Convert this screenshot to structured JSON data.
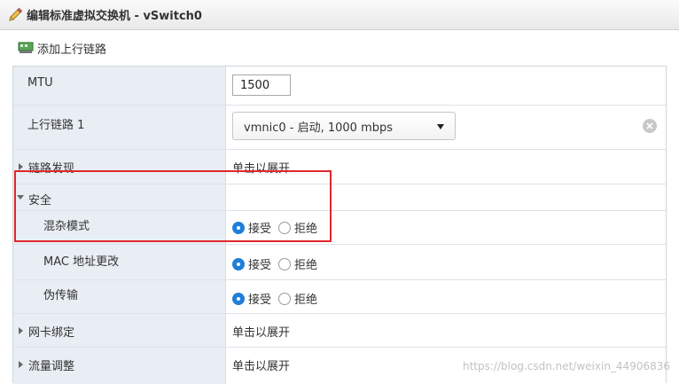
{
  "window": {
    "title": "编辑标准虚拟交换机 - vSwitch0"
  },
  "toolbar": {
    "add_uplink_label": "添加上行链路"
  },
  "rows": {
    "mtu": {
      "label": "MTU",
      "value": "1500"
    },
    "uplink1": {
      "label": "上行链路 1",
      "selected": "vmnic0 - 启动, 1000 mbps"
    },
    "link_discovery": {
      "label": "链路发现",
      "value": "单击以展开"
    },
    "security": {
      "label": "安全"
    },
    "promiscuous": {
      "label": "混杂模式",
      "accept": "接受",
      "reject": "拒绝",
      "selected": "接受"
    },
    "mac_change": {
      "label": "MAC 地址更改",
      "accept": "接受",
      "reject": "拒绝",
      "selected": "接受"
    },
    "forged": {
      "label": "伪传输",
      "accept": "接受",
      "reject": "拒绝",
      "selected": "接受"
    },
    "nic_teaming": {
      "label": "网卡绑定",
      "value": "单击以展开"
    },
    "traffic_shaping": {
      "label": "流量调整",
      "value": "单击以展开"
    }
  },
  "watermark": "https://blog.csdn.net/weixin_44906836",
  "colors": {
    "accent": "#1f7fd8",
    "highlight": "#e0272c",
    "label_bg": "#e8eef3"
  }
}
